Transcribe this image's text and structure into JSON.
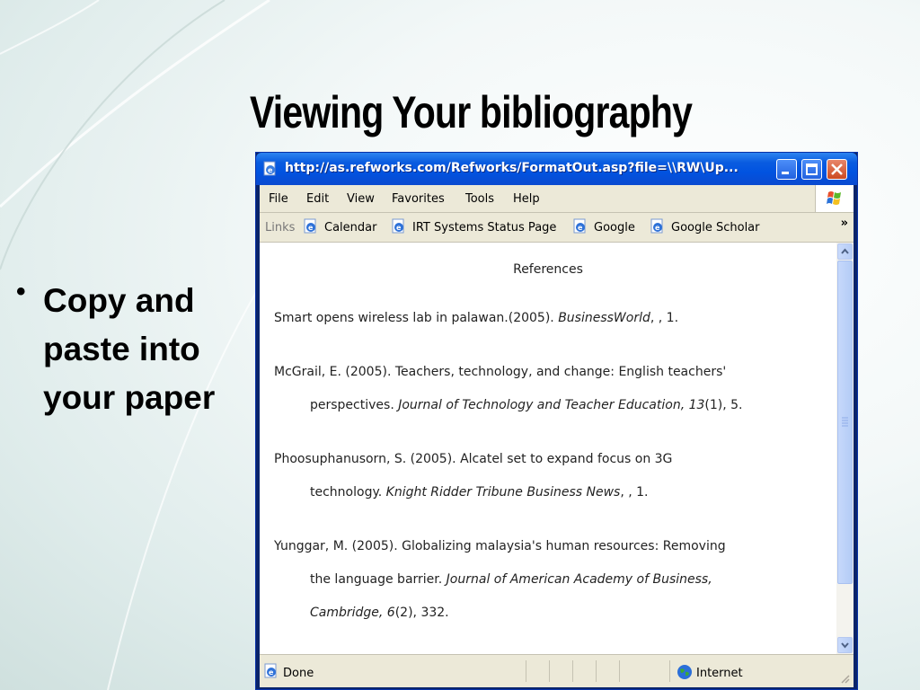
{
  "slide": {
    "title": "Viewing Your bibliography",
    "bullet": "Copy and paste into your paper"
  },
  "window": {
    "title": "http://as.refworks.com/Refworks/FormatOut.asp?file=\\\\RW\\Up...",
    "menu": [
      "File",
      "Edit",
      "View",
      "Favorites",
      "Tools",
      "Help"
    ],
    "links_label": "Links",
    "links": [
      "Calendar",
      "IRT Systems Status Page",
      "Google",
      "Google Scholar"
    ],
    "chevron": "»",
    "status": {
      "text": "Done",
      "zone": "Internet"
    }
  },
  "document": {
    "heading": "References",
    "references": [
      {
        "line1": "Smart opens wireless lab in palawan.(2005). ",
        "italic1": "BusinessWorld",
        "after1": ", , 1."
      },
      {
        "line1": "McGrail, E. (2005). Teachers, technology, and change: English teachers'",
        "line2": "perspectives. ",
        "italic2": "Journal of Technology and Teacher Education, 13",
        "after2": "(1), 5."
      },
      {
        "line1": "Phoosuphanusorn, S. (2005). Alcatel set to expand focus on 3G",
        "line2": "technology. ",
        "italic2": "Knight Ridder Tribune Business News",
        "after2": ", , 1."
      },
      {
        "line1": "Yunggar, M. (2005). Globalizing malaysia's human resources: Removing",
        "line2": "the language barrier. ",
        "italic2": "Journal of American Academy of Business,",
        "line3_italic": "Cambridge, 6",
        "after3": "(2), 332."
      }
    ]
  },
  "colors": {
    "titlebar": "#0153e0",
    "chrome": "#ece9d8",
    "background": "#e6f0ef"
  }
}
